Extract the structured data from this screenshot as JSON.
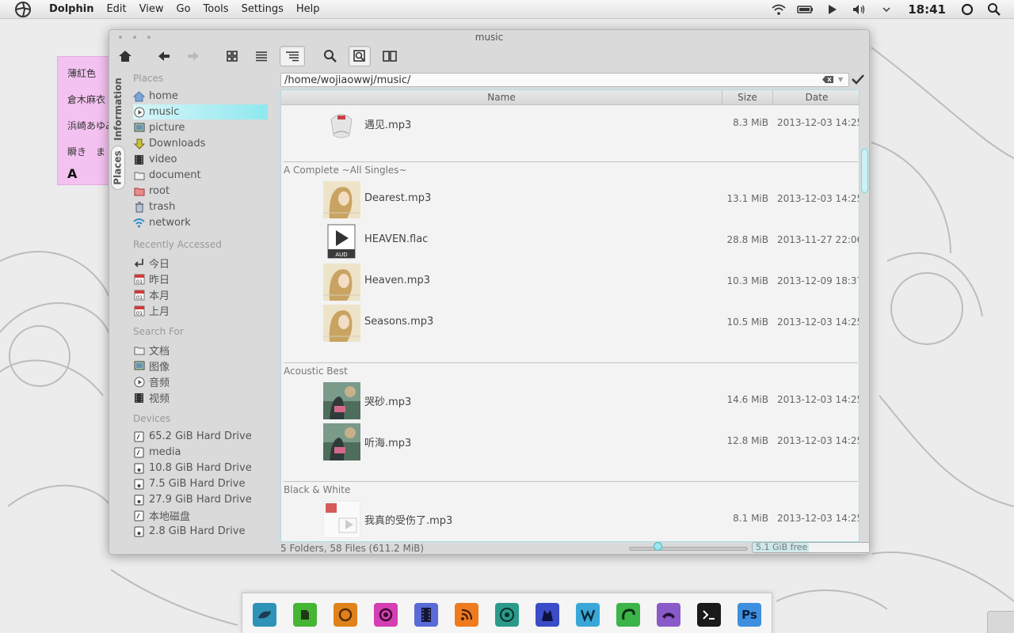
{
  "top_panel": {
    "menu": [
      "Dolphin",
      "Edit",
      "View",
      "Go",
      "Tools",
      "Settings",
      "Help"
    ],
    "clock": "18:41",
    "tray_icons": [
      "wifi-icon",
      "battery-icon",
      "play-icon",
      "volume-icon",
      "chevron-down-icon",
      "power-icon",
      "search-icon"
    ]
  },
  "sticky_note": {
    "lines": [
      "薄紅色",
      "倉木麻衣",
      "浜崎あゆみ",
      "瞬き　ま",
      "A"
    ]
  },
  "window": {
    "title": "music",
    "side_tabs": [
      "Information",
      "Places"
    ],
    "toolbar_icons": [
      "home-icon",
      "back-icon",
      "forward-icon",
      "icons-view-icon",
      "details-view-icon",
      "tree-view-icon",
      "find-icon",
      "preview-icon",
      "split-icon"
    ]
  },
  "places": {
    "section_places": "Places",
    "places_items": [
      "home",
      "music",
      "picture",
      "Downloads",
      "video",
      "document",
      "root",
      "trash",
      "network"
    ],
    "section_recent": "Recently Accessed",
    "recent_items": [
      "今日",
      "昨日",
      "本月",
      "上月"
    ],
    "calendar_day": "01",
    "section_search": "Search For",
    "search_items": [
      "文档",
      "图像",
      "音频",
      "视频"
    ],
    "section_devices": "Devices",
    "devices": [
      "65.2 GiB Hard Drive",
      "media",
      "10.8 GiB Hard Drive",
      "7.5 GiB Hard Drive",
      "27.9 GiB Hard Drive",
      "本地磁盘",
      "2.8 GiB Hard Drive"
    ]
  },
  "location": {
    "path": "/home/wojiaowwj/music/"
  },
  "columns": {
    "name": "Name",
    "size": "Size",
    "date": "Date"
  },
  "groups": [
    {
      "title": ""
    },
    {
      "title": "A Complete ~All Singles~"
    },
    {
      "title": "Acoustic Best"
    },
    {
      "title": "Black & White"
    }
  ],
  "files": [
    {
      "name": "遇见.mp3",
      "size": "8.3 MiB",
      "date": "2013-12-03 14:25"
    },
    {
      "name": "Dearest.mp3",
      "size": "13.1 MiB",
      "date": "2013-12-03 14:25"
    },
    {
      "name": "HEAVEN.flac",
      "size": "28.8 MiB",
      "date": "2013-11-27 22:06"
    },
    {
      "name": "Heaven.mp3",
      "size": "10.3 MiB",
      "date": "2013-12-09 18:37"
    },
    {
      "name": "Seasons.mp3",
      "size": "10.5 MiB",
      "date": "2013-12-03 14:25"
    },
    {
      "name": "哭砂.mp3",
      "size": "14.6 MiB",
      "date": "2013-12-03 14:25"
    },
    {
      "name": "听海.mp3",
      "size": "12.8 MiB",
      "date": "2013-12-03 14:25"
    },
    {
      "name": "我真的受伤了.mp3",
      "size": "8.1 MiB",
      "date": "2013-12-03 14:25"
    }
  ],
  "flac_label": "AUD",
  "status": {
    "summary": "5 Folders, 58 Files (611.2 MiB)",
    "free": "5.1 GiB free",
    "zoom_fraction": 0.22
  },
  "dock": {
    "icons": [
      "dolphin-icon",
      "evernote-icon",
      "firefox-icon",
      "music-player-icon",
      "video-player-icon",
      "rss-icon",
      "chrome-icon",
      "wolf-icon",
      "wiz-icon",
      "green-app-icon",
      "phone-icon",
      "terminal-icon",
      "photoshop-icon"
    ],
    "ps_label": "Ps"
  }
}
